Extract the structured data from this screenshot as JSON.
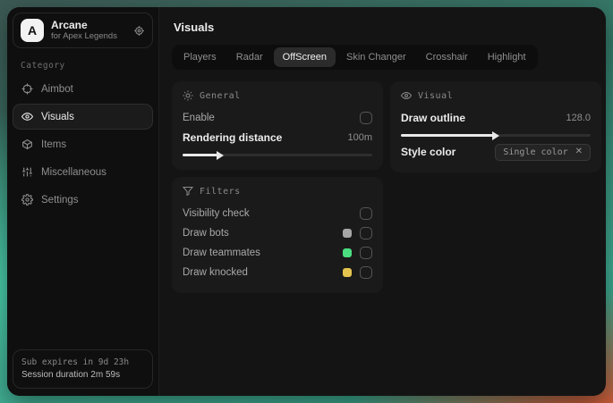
{
  "app": {
    "logo_letter": "A",
    "name": "Arcane",
    "subtitle": "for Apex Legends"
  },
  "sidebar": {
    "category_label": "Category",
    "items": [
      {
        "label": "Aimbot"
      },
      {
        "label": "Visuals"
      },
      {
        "label": "Items"
      },
      {
        "label": "Miscellaneous"
      },
      {
        "label": "Settings"
      }
    ],
    "status": {
      "line1": "Sub expires in 9d 23h",
      "line2": "Session duration 2m 59s"
    }
  },
  "header": {
    "title": "Visuals"
  },
  "tabs": [
    {
      "label": "Players"
    },
    {
      "label": "Radar"
    },
    {
      "label": "OffScreen"
    },
    {
      "label": "Skin Changer"
    },
    {
      "label": "Crosshair"
    },
    {
      "label": "Highlight"
    }
  ],
  "sections": {
    "general": {
      "title": "General",
      "enable_label": "Enable",
      "rendering": {
        "label": "Rendering distance",
        "value": "100m",
        "percent": 20
      }
    },
    "visual": {
      "title": "Visual",
      "outline": {
        "label": "Draw outline",
        "value": "128.0",
        "percent": 50
      },
      "style_color": {
        "label": "Style color",
        "chip": "Single color",
        "close": "✕"
      }
    },
    "filters": {
      "title": "Filters",
      "rows": [
        {
          "label": "Visibility check"
        },
        {
          "label": "Draw bots",
          "swatch": "#a6a6a6"
        },
        {
          "label": "Draw teammates",
          "swatch": "#4ade80"
        },
        {
          "label": "Draw knocked",
          "swatch": "#e4c44f"
        }
      ]
    }
  },
  "colors": {
    "accent_teal": "#3fae94",
    "accent_orange": "#e2532e",
    "card_bg": "#1a1a1a",
    "slider_fill": "#e8e8e8"
  }
}
